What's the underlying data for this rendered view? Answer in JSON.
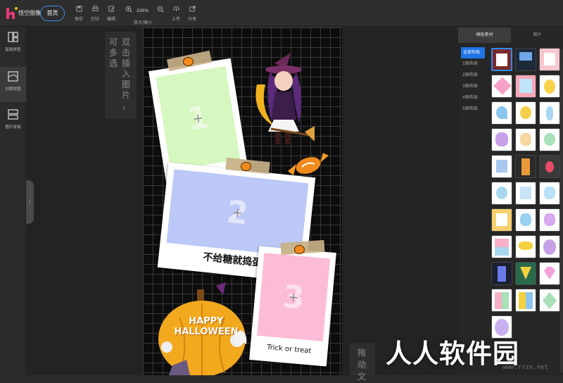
{
  "app": {
    "title": "悟空图像",
    "home_label": "首页"
  },
  "toolbar": {
    "save": "保存",
    "print": "打印",
    "edit": "编辑",
    "zoom_value": "100%",
    "zoom_label": "放大/缩小",
    "upload": "上传",
    "share": "分享"
  },
  "leftnav": {
    "items": [
      {
        "label": "智能拼图"
      },
      {
        "label": "创意拼图"
      },
      {
        "label": "图片拼接"
      }
    ]
  },
  "hints": {
    "insert": [
      "可",
      "多",
      "选"
    ],
    "insert2": [
      "双",
      "击",
      "插",
      "入",
      "图",
      "片",
      "，"
    ],
    "drag": [
      "拖",
      "动",
      "文"
    ]
  },
  "canvas": {
    "frames": [
      {
        "number": "1"
      },
      {
        "number": "2",
        "caption": "不给糖就捣蛋"
      },
      {
        "number": "3",
        "caption": "Trick or treat"
      }
    ],
    "halloween_text": [
      "HAPPY",
      "HALLOWEEN"
    ]
  },
  "rightpanel": {
    "tabs": [
      "模板素材",
      "图片"
    ],
    "categories": [
      "全部布局",
      "1图布局",
      "2图布局",
      "3图布局",
      "4图布局",
      "5图布局"
    ]
  },
  "watermark": {
    "text": "人人软件园",
    "sub": "www.rrzx.net"
  }
}
